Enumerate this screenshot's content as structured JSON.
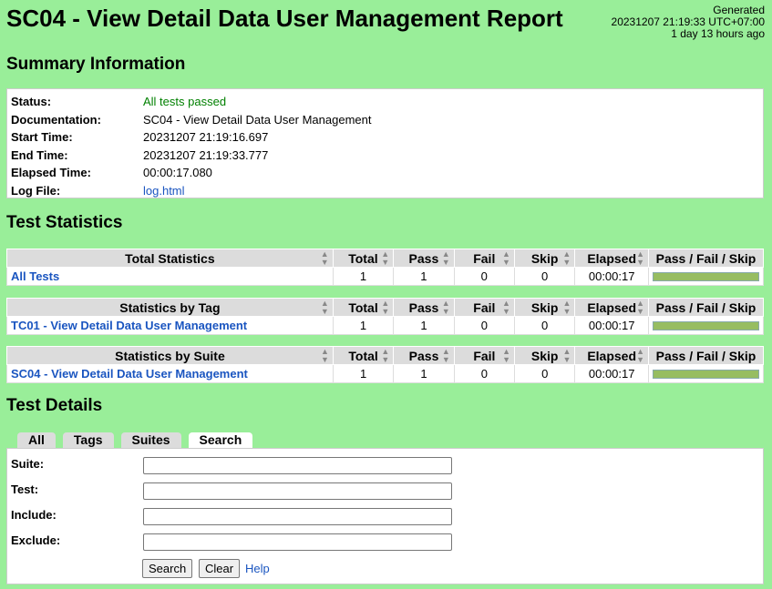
{
  "header": {
    "title": "SC04 - View Detail Data User Management Report",
    "generated_label": "Generated",
    "generated_time": "20231207 21:19:33 UTC+07:00",
    "generated_ago": "1 day 13 hours ago"
  },
  "summary": {
    "title": "Summary Information",
    "rows": [
      {
        "label": "Status:",
        "value": "All tests passed"
      },
      {
        "label": "Documentation:",
        "value": "SC04 - View Detail Data User Management"
      },
      {
        "label": "Start Time:",
        "value": "20231207 21:19:16.697"
      },
      {
        "label": "End Time:",
        "value": "20231207 21:19:33.777"
      },
      {
        "label": "Elapsed Time:",
        "value": "00:00:17.080"
      },
      {
        "label": "Log File:",
        "value": "log.html"
      }
    ]
  },
  "statistics": {
    "title": "Test Statistics",
    "columns": [
      "Total",
      "Pass",
      "Fail",
      "Skip",
      "Elapsed",
      "Pass / Fail / Skip"
    ],
    "tables": [
      {
        "header": "Total Statistics",
        "name": "All Tests",
        "total": "1",
        "pass": "1",
        "fail": "0",
        "skip": "0",
        "elapsed": "00:00:17",
        "pass_ratio": 1.0
      },
      {
        "header": "Statistics by Tag",
        "name": "TC01 - View Detail Data User Management",
        "total": "1",
        "pass": "1",
        "fail": "0",
        "skip": "0",
        "elapsed": "00:00:17",
        "pass_ratio": 1.0
      },
      {
        "header": "Statistics by Suite",
        "name": "SC04 - View Detail Data User Management",
        "total": "1",
        "pass": "1",
        "fail": "0",
        "skip": "0",
        "elapsed": "00:00:17",
        "pass_ratio": 1.0
      }
    ]
  },
  "details": {
    "title": "Test Details",
    "tabs": [
      "All",
      "Tags",
      "Suites",
      "Search"
    ],
    "active_tab": "Search",
    "fields": [
      {
        "label": "Suite:",
        "value": ""
      },
      {
        "label": "Test:",
        "value": ""
      },
      {
        "label": "Include:",
        "value": ""
      },
      {
        "label": "Exclude:",
        "value": ""
      }
    ],
    "search_button": "Search",
    "clear_button": "Clear",
    "help_link": "Help"
  },
  "colors": {
    "background": "#99ee99",
    "pass_bar": "#97bd61",
    "link": "#1a55c0",
    "pass_text": "#008000"
  }
}
